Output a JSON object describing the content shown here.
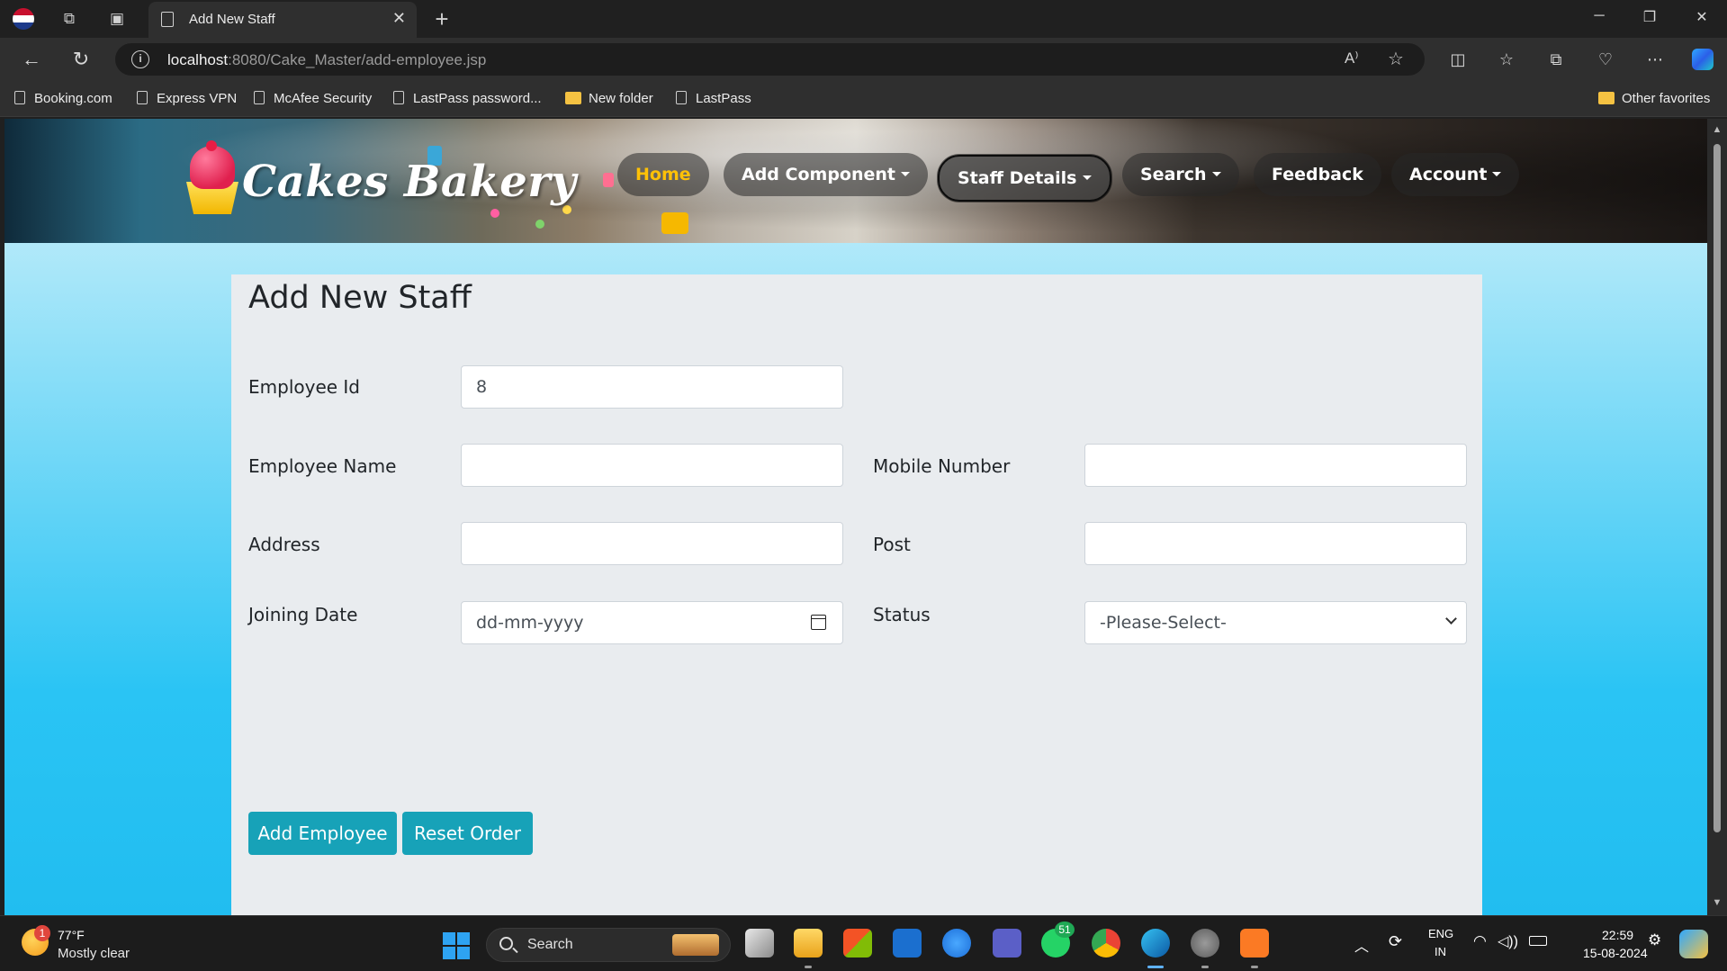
{
  "browser": {
    "tab_title": "Add New Staff",
    "url_host": "localhost",
    "url_path": ":8080/Cake_Master/add-employee.jsp",
    "bookmarks": [
      {
        "label": "Booking.com",
        "type": "page"
      },
      {
        "label": "Express VPN",
        "type": "page"
      },
      {
        "label": "McAfee Security",
        "type": "page"
      },
      {
        "label": "LastPass password...",
        "type": "page"
      },
      {
        "label": "New folder",
        "type": "folder"
      },
      {
        "label": "LastPass",
        "type": "page"
      }
    ],
    "other_favorites": "Other favorites"
  },
  "site": {
    "logo_text": "Cakes Bakery",
    "nav": {
      "home": "Home",
      "add_component": "Add Component",
      "staff_details": "Staff Details",
      "search": "Search",
      "feedback": "Feedback",
      "account": "Account"
    },
    "colors": {
      "active_nav": "#ffc107",
      "button": "#17a2b8"
    }
  },
  "form": {
    "title": "Add New Staff",
    "employee_id_label": "Employee Id",
    "employee_id_value": "8",
    "employee_name_label": "Employee Name",
    "employee_name_value": "",
    "mobile_label": "Mobile Number",
    "mobile_value": "",
    "address_label": "Address",
    "address_value": "",
    "post_label": "Post",
    "post_value": "",
    "joining_date_label": "Joining Date",
    "joining_date_placeholder": "dd-mm-yyyy",
    "status_label": "Status",
    "status_selected": "-Please-Select-",
    "add_button": "Add Employee",
    "reset_button": "Reset Order"
  },
  "taskbar": {
    "weather_badge": "1",
    "temperature": "77°F",
    "weather_desc": "Mostly clear",
    "search_label": "Search",
    "whatsapp_badge": "51",
    "lang_top": "ENG",
    "lang_bottom": "IN",
    "time": "22:59",
    "date": "15-08-2024"
  }
}
